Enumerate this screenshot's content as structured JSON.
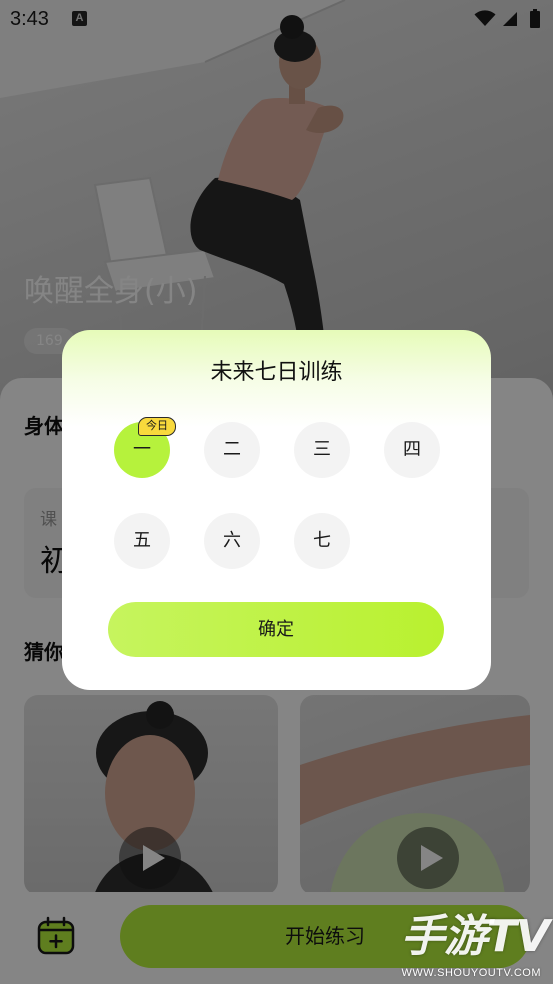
{
  "status_bar": {
    "time": "3:43",
    "notification_glyph": "A",
    "icons": [
      "a-icon",
      "wifi-icon",
      "signal-icon",
      "battery-icon"
    ]
  },
  "hero": {
    "title": "唤醒全身(小)",
    "tag": "169"
  },
  "sheet": {
    "section_title": "身体",
    "info_card": {
      "label": "课",
      "value": "初"
    },
    "recommend_title": "猜你",
    "videos": [
      {
        "icon": "play-icon"
      },
      {
        "icon": "play-icon"
      }
    ]
  },
  "bottom_bar": {
    "calendar_icon": "calendar-plus-icon",
    "start_label": "开始练习"
  },
  "modal": {
    "title": "未来七日训练",
    "days": [
      {
        "label": "一",
        "selected": true,
        "badge": "今日"
      },
      {
        "label": "二",
        "selected": false
      },
      {
        "label": "三",
        "selected": false
      },
      {
        "label": "四",
        "selected": false
      },
      {
        "label": "五",
        "selected": false
      },
      {
        "label": "六",
        "selected": false
      },
      {
        "label": "七",
        "selected": false
      }
    ],
    "confirm_label": "确定"
  },
  "watermark": {
    "brand": "手游TV",
    "url": "WWW.SHOUYOUTV.COM"
  },
  "colors": {
    "accent": "#b6f23c",
    "badge": "#f8d93c",
    "overlay": "rgba(0,0,0,0.48)"
  }
}
